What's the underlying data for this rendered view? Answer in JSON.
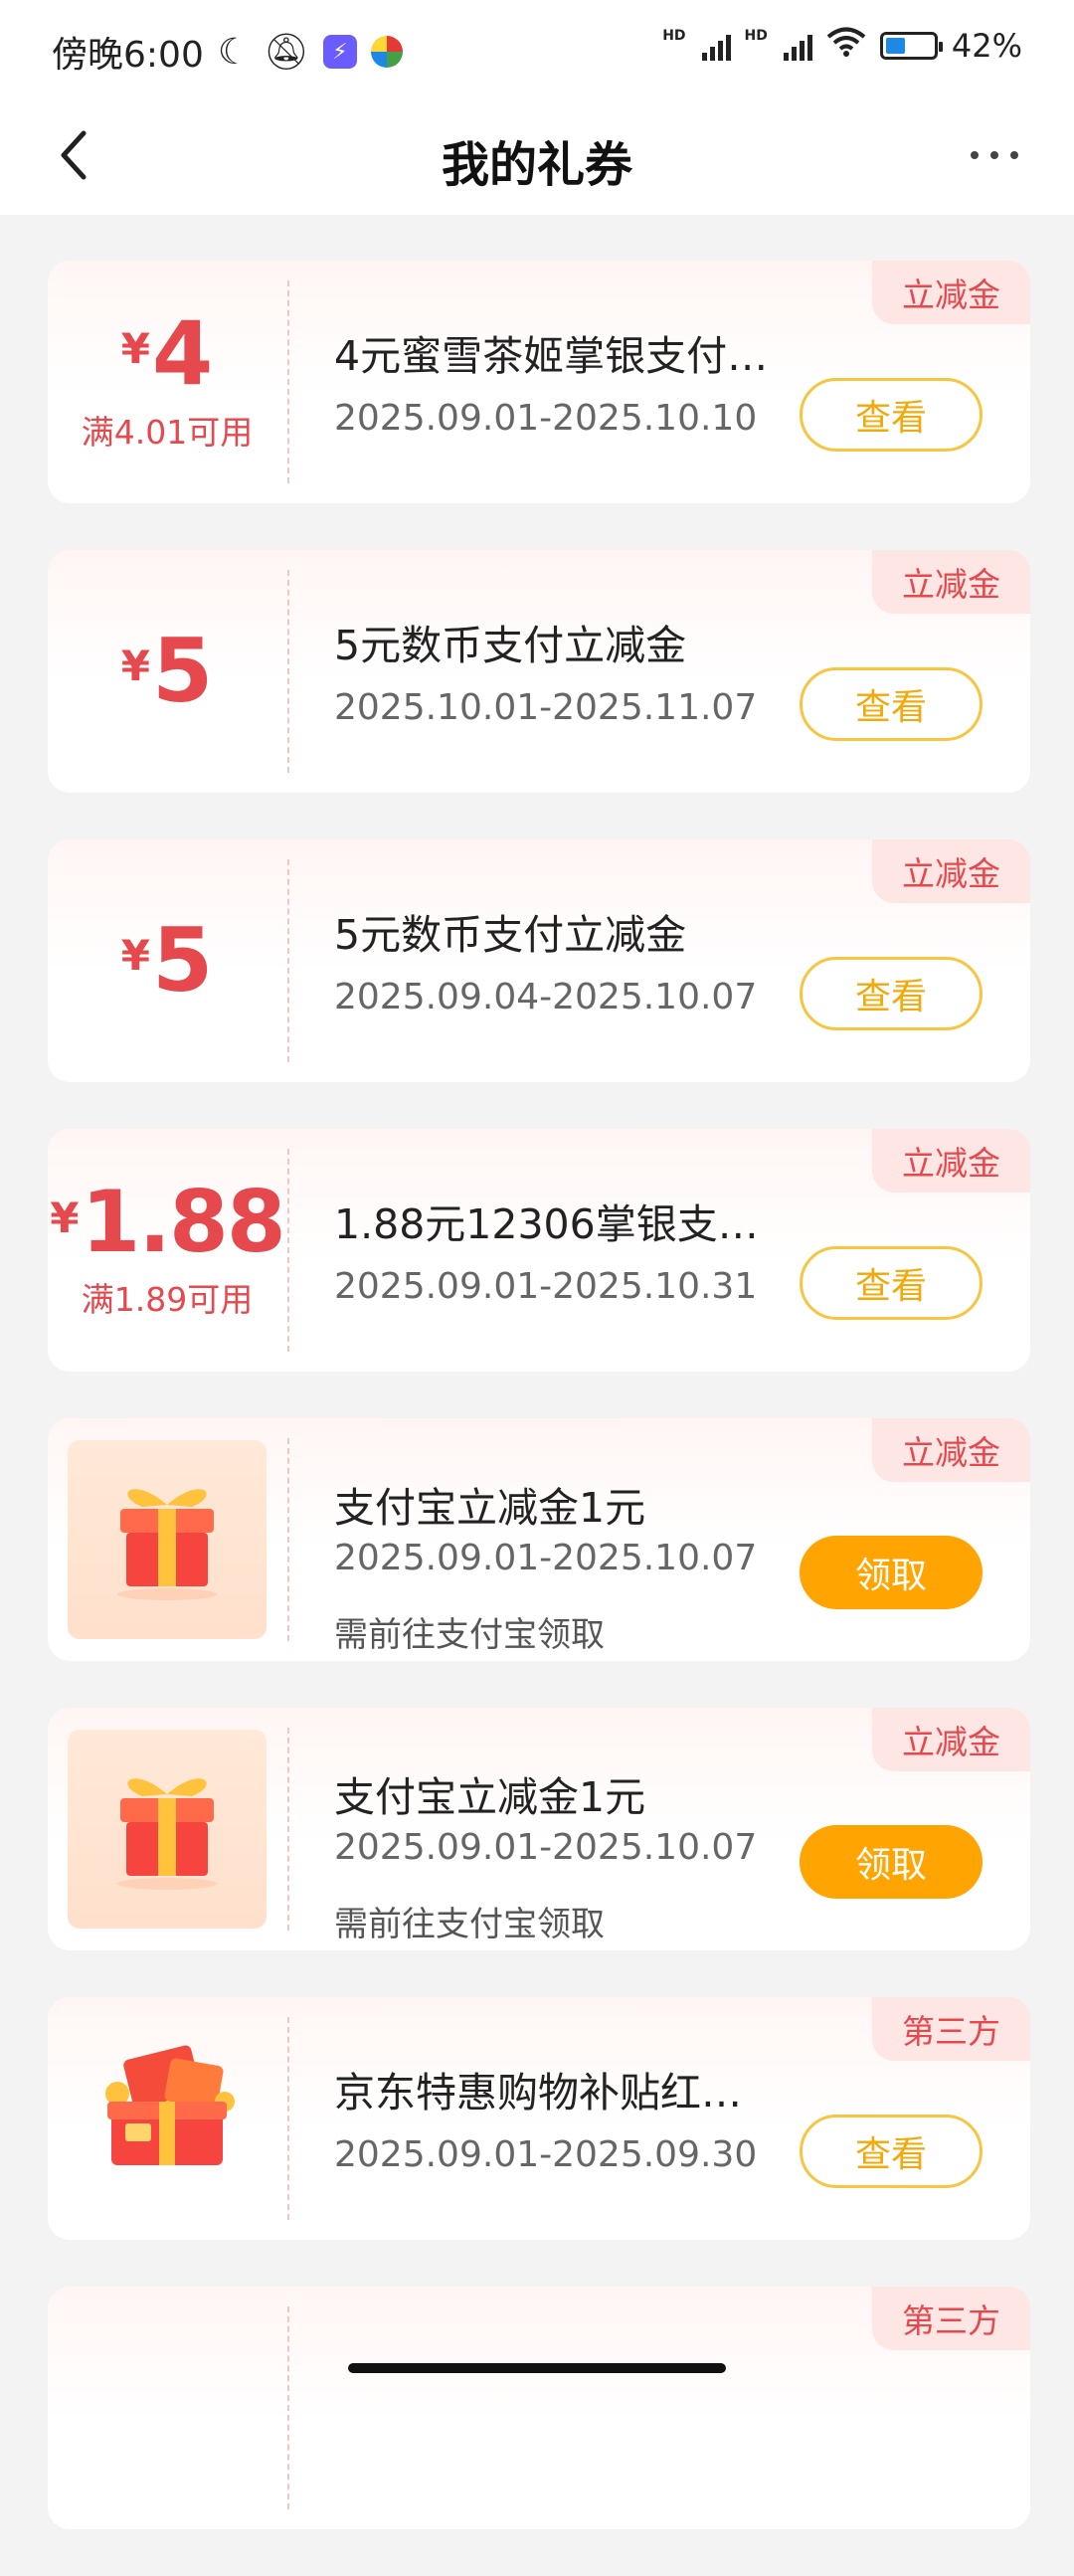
{
  "status_bar": {
    "time": "傍晚6:00",
    "battery": "42%",
    "battery_level": 0.42,
    "hd1": "HD",
    "hd2": "HD"
  },
  "nav": {
    "title": "我的礼券"
  },
  "colors": {
    "accent_red": "#e5484d",
    "button_orange": "#ffa400",
    "outline_yellow": "#f7c541"
  },
  "coupons": [
    {
      "tag": "立减金",
      "currency": "¥",
      "amount": "4",
      "condition": "满4.01可用",
      "title": "4元蜜雪茶姬掌银支付…",
      "date": "2025.09.01-2025.10.10",
      "button": "查看"
    },
    {
      "tag": "立减金",
      "currency": "¥",
      "amount": "5",
      "title": "5元数币支付立减金",
      "date": "2025.10.01-2025.11.07",
      "button": "查看"
    },
    {
      "tag": "立减金",
      "currency": "¥",
      "amount": "5",
      "title": "5元数币支付立减金",
      "date": "2025.09.04-2025.10.07",
      "button": "查看"
    },
    {
      "tag": "立减金",
      "currency": "¥",
      "amount": "1.88",
      "condition": "满1.89可用",
      "title": "1.88元12306掌银支…",
      "date": "2025.09.01-2025.10.31",
      "button": "查看"
    },
    {
      "tag": "立减金",
      "icon": "gift-box-icon",
      "title": "支付宝立减金1元",
      "date": "2025.09.01-2025.10.07",
      "note": "需前往支付宝领取",
      "button": "领取"
    },
    {
      "tag": "立减金",
      "icon": "gift-box-icon",
      "title": "支付宝立减金1元",
      "date": "2025.09.01-2025.10.07",
      "note": "需前往支付宝领取",
      "button": "领取"
    },
    {
      "tag": "第三方",
      "icon": "red-packet-box-icon",
      "title": "京东特惠购物补贴红…",
      "date": "2025.09.01-2025.09.30",
      "button": "查看"
    },
    {
      "tag": "第三方"
    }
  ]
}
